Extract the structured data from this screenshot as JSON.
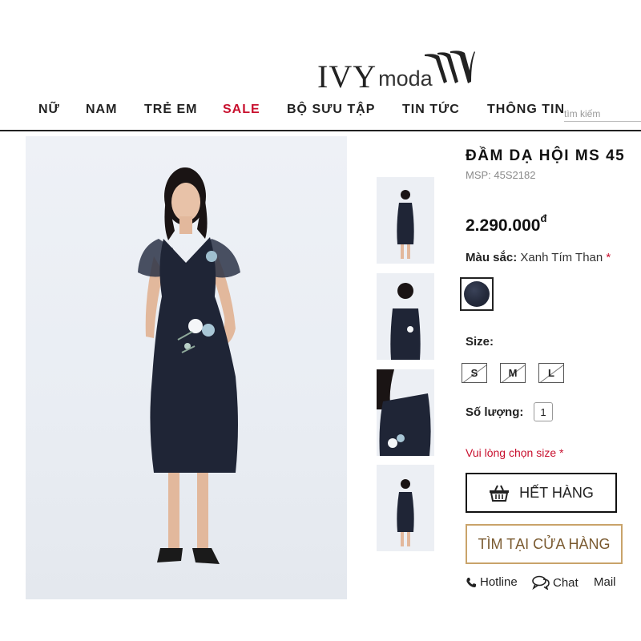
{
  "brand": {
    "logo_main": "IVY",
    "logo_sub": "moda"
  },
  "nav": {
    "items": [
      {
        "label": "NỮ"
      },
      {
        "label": "NAM"
      },
      {
        "label": "TRẺ EM"
      },
      {
        "label": "SALE"
      },
      {
        "label": "BỘ SƯU TẬP"
      },
      {
        "label": "TIN TỨC"
      },
      {
        "label": "THÔNG TIN"
      }
    ],
    "search_placeholder": "tìm kiếm"
  },
  "product": {
    "title": "ĐẦM DẠ HỘI MS 45",
    "sku": "MSP: 45S2182",
    "price": "2.290.000",
    "currency": "đ",
    "color_label": "Màu sắc:",
    "color_value": "Xanh Tím Than",
    "required_mark": "*",
    "swatch_color": "#252b3c",
    "size_label": "Size:",
    "sizes": [
      {
        "label": "S",
        "available": false
      },
      {
        "label": "M",
        "available": false
      },
      {
        "label": "L",
        "available": false
      }
    ],
    "qty_label": "Số lượng:",
    "qty_value": "1",
    "size_warning": "Vui lòng chọn size",
    "sold_out_label": "HẾT HÀNG",
    "find_store_label": "TÌM TẠI CỬA HÀNG"
  },
  "contact": {
    "hotline": "Hotline",
    "chat": "Chat",
    "mail": "Mail"
  },
  "colors": {
    "accent_red": "#c8102e",
    "store_gold": "#c9a36a",
    "dress_navy": "#1f2536"
  }
}
